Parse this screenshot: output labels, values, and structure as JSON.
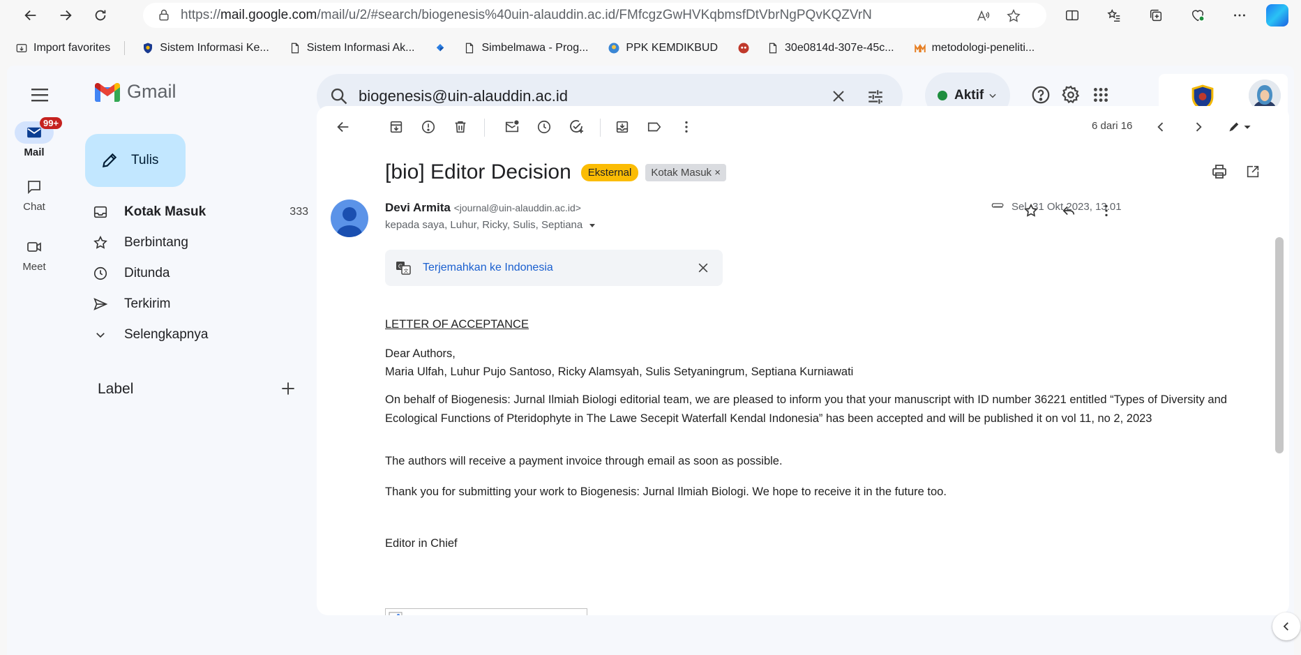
{
  "browser": {
    "url_prefix": "https://",
    "url_host": "mail.google.com",
    "url_path": "/mail/u/2/#search/biogenesis%40uin-alauddin.ac.id/FMfcgzGwHVKqbmsfDtVbrNgPQvKQZVrN"
  },
  "bookmarks": [
    {
      "label": "Import favorites",
      "icon": "import-icon"
    },
    {
      "label": "Sistem Informasi Ke...",
      "icon": "shield-logo-icon"
    },
    {
      "label": "Sistem Informasi Ak...",
      "icon": "page-icon"
    },
    {
      "label": "",
      "icon": "diamond-logo-icon"
    },
    {
      "label": "Simbelmawa - Prog...",
      "icon": "page-icon"
    },
    {
      "label": "PPK KEMDIKBUD",
      "icon": "globe-logo-icon"
    },
    {
      "label": "",
      "icon": "mascot-logo-icon"
    },
    {
      "label": "30e0814d-307e-45c...",
      "icon": "page-icon"
    },
    {
      "label": "metodologi-peneliti...",
      "icon": "m-logo-icon"
    }
  ],
  "gmail": {
    "logo_text": "Gmail",
    "search_query": "biogenesis@uin-alauddin.ac.id",
    "status_label": "Aktif",
    "compose_label": "Tulis",
    "rail": {
      "mail_label": "Mail",
      "mail_badge": "99+",
      "chat_label": "Chat",
      "meet_label": "Meet"
    },
    "nav": [
      {
        "label": "Kotak Masuk",
        "count": "333"
      },
      {
        "label": "Berbintang",
        "count": ""
      },
      {
        "label": "Ditunda",
        "count": ""
      },
      {
        "label": "Terkirim",
        "count": ""
      },
      {
        "label": "Selengkapnya",
        "count": ""
      }
    ],
    "label_heading": "Label"
  },
  "email": {
    "pager": "6 dari 16",
    "subject": "[bio] Editor Decision",
    "tag_external": "Eksternal",
    "tag_inbox": "Kotak Masuk",
    "tag_inbox_close": "×",
    "sender_name": "Devi Armita",
    "sender_email": "<journal@uin-alauddin.ac.id>",
    "recipients": "kepada saya, Luhur, Ricky, Sulis, Septiana",
    "date": "Sel, 31 Okt 2023, 13.01",
    "translate_link": "Terjemahkan ke Indonesia",
    "body": {
      "heading": "LETTER OF ACCEPTANCE",
      "greeting": "Dear Authors,",
      "authors": "Maria Ulfah, Luhur Pujo Santoso, Ricky Alamsyah, Sulis Setyaningrum, Septiana Kurniawati",
      "paragraph1": "On behalf of Biogenesis: Jurnal Ilmiah Biologi editorial team, we are pleased to inform you that your manuscript with ID number 36221 entitled “Types of Diversity and Ecological Functions of Pteridophyte in The Lawe Secepit Waterfall Kendal Indonesia” has been accepted and will be published it on vol 11, no 2, 2023",
      "paragraph2": "The authors will receive a payment invoice through email as soon as possible.",
      "paragraph3": "Thank you for submitting your work to Biogenesis: Jurnal Ilmiah Biologi. We hope to receive it in the future too.",
      "signoff": "Editor in Chief"
    }
  },
  "colors": {
    "compose_bg": "#c2e7ff",
    "tag_external": "#fbbc04",
    "badge": "#c5221f",
    "status_dot": "#1e8e3e",
    "link": "#1a5fcf"
  }
}
